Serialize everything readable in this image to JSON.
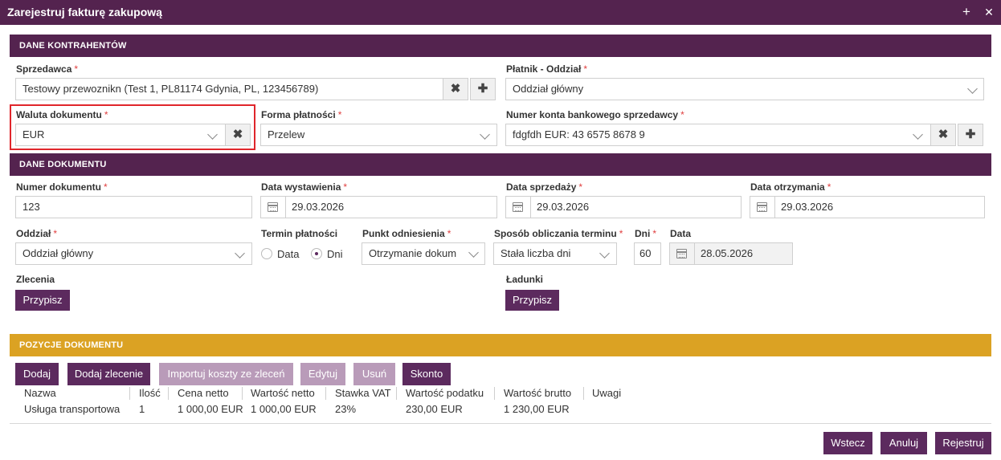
{
  "window": {
    "title": "Zarejestruj fakturę zakupową",
    "add_icon": "+",
    "close_icon": "✕"
  },
  "sections": {
    "kontrahenci": "DANE KONTRAHENTÓW",
    "dokument": "DANE DOKUMENTU",
    "pozycje": "POZYCJE DOKUMENTU"
  },
  "kontrahenci": {
    "sprzedawca": {
      "label": "Sprzedawca",
      "value": "Testowy przewoznikn (Test 1, PL81174 Gdynia, PL, 123456789)"
    },
    "platnik": {
      "label": "Płatnik - Oddział",
      "value": "Oddział główny"
    },
    "waluta": {
      "label": "Waluta dokumentu",
      "value": "EUR"
    },
    "forma": {
      "label": "Forma płatności",
      "value": "Przelew"
    },
    "konto": {
      "label": "Numer konta bankowego sprzedawcy",
      "value": "fdgfdh EUR: 43 6575 8678 9"
    },
    "required_mark": "*",
    "clear_icon": "✖",
    "add_icon": "✚"
  },
  "dokument": {
    "numer": {
      "label": "Numer dokumentu",
      "value": "123"
    },
    "data_wystawienia": {
      "label": "Data wystawienia",
      "value": "29.03.2026"
    },
    "data_sprzedazy": {
      "label": "Data sprzedaży",
      "value": "29.03.2026"
    },
    "data_otrzymania": {
      "label": "Data otrzymania",
      "value": "29.03.2026"
    },
    "oddzial": {
      "label": "Oddział",
      "value": "Oddział główny"
    },
    "termin": {
      "label": "Termin płatności",
      "options": [
        "Data",
        "Dni"
      ],
      "selected": "Dni"
    },
    "punkt": {
      "label": "Punkt odniesienia",
      "value": "Otrzymanie dokum"
    },
    "sposob": {
      "label": "Sposób obliczania terminu",
      "value": "Stała liczba dni"
    },
    "dni": {
      "label": "Dni",
      "value": "60"
    },
    "data": {
      "label": "Data",
      "value": "28.05.2026"
    },
    "zlecenia": {
      "label": "Zlecenia",
      "button": "Przypisz"
    },
    "ladunki": {
      "label": "Ładunki",
      "button": "Przypisz"
    }
  },
  "pozycje": {
    "buttons": {
      "dodaj": "Dodaj",
      "dodaj_zlecenie": "Dodaj zlecenie",
      "importuj": "Importuj koszty ze zleceń",
      "edytuj": "Edytuj",
      "usun": "Usuń",
      "skonto": "Skonto"
    },
    "columns": [
      "Nazwa",
      "Ilość",
      "Cena netto",
      "Wartość netto",
      "Stawka VAT",
      "Wartość podatku",
      "Wartość brutto",
      "Uwagi"
    ],
    "rows": [
      [
        "Usługa transportowa",
        "1",
        "1 000,00 EUR",
        "1 000,00 EUR",
        "23%",
        "230,00 EUR",
        "1 230,00 EUR",
        ""
      ]
    ]
  },
  "footer": {
    "wstecz": "Wstecz",
    "anuluj": "Anuluj",
    "rejestruj": "Rejestruj"
  },
  "colors": {
    "header": "#54234f",
    "button": "#5c2a5e",
    "button_disabled": "#b99bb9",
    "section_gold": "#dba223",
    "highlight": "#e0262b"
  }
}
